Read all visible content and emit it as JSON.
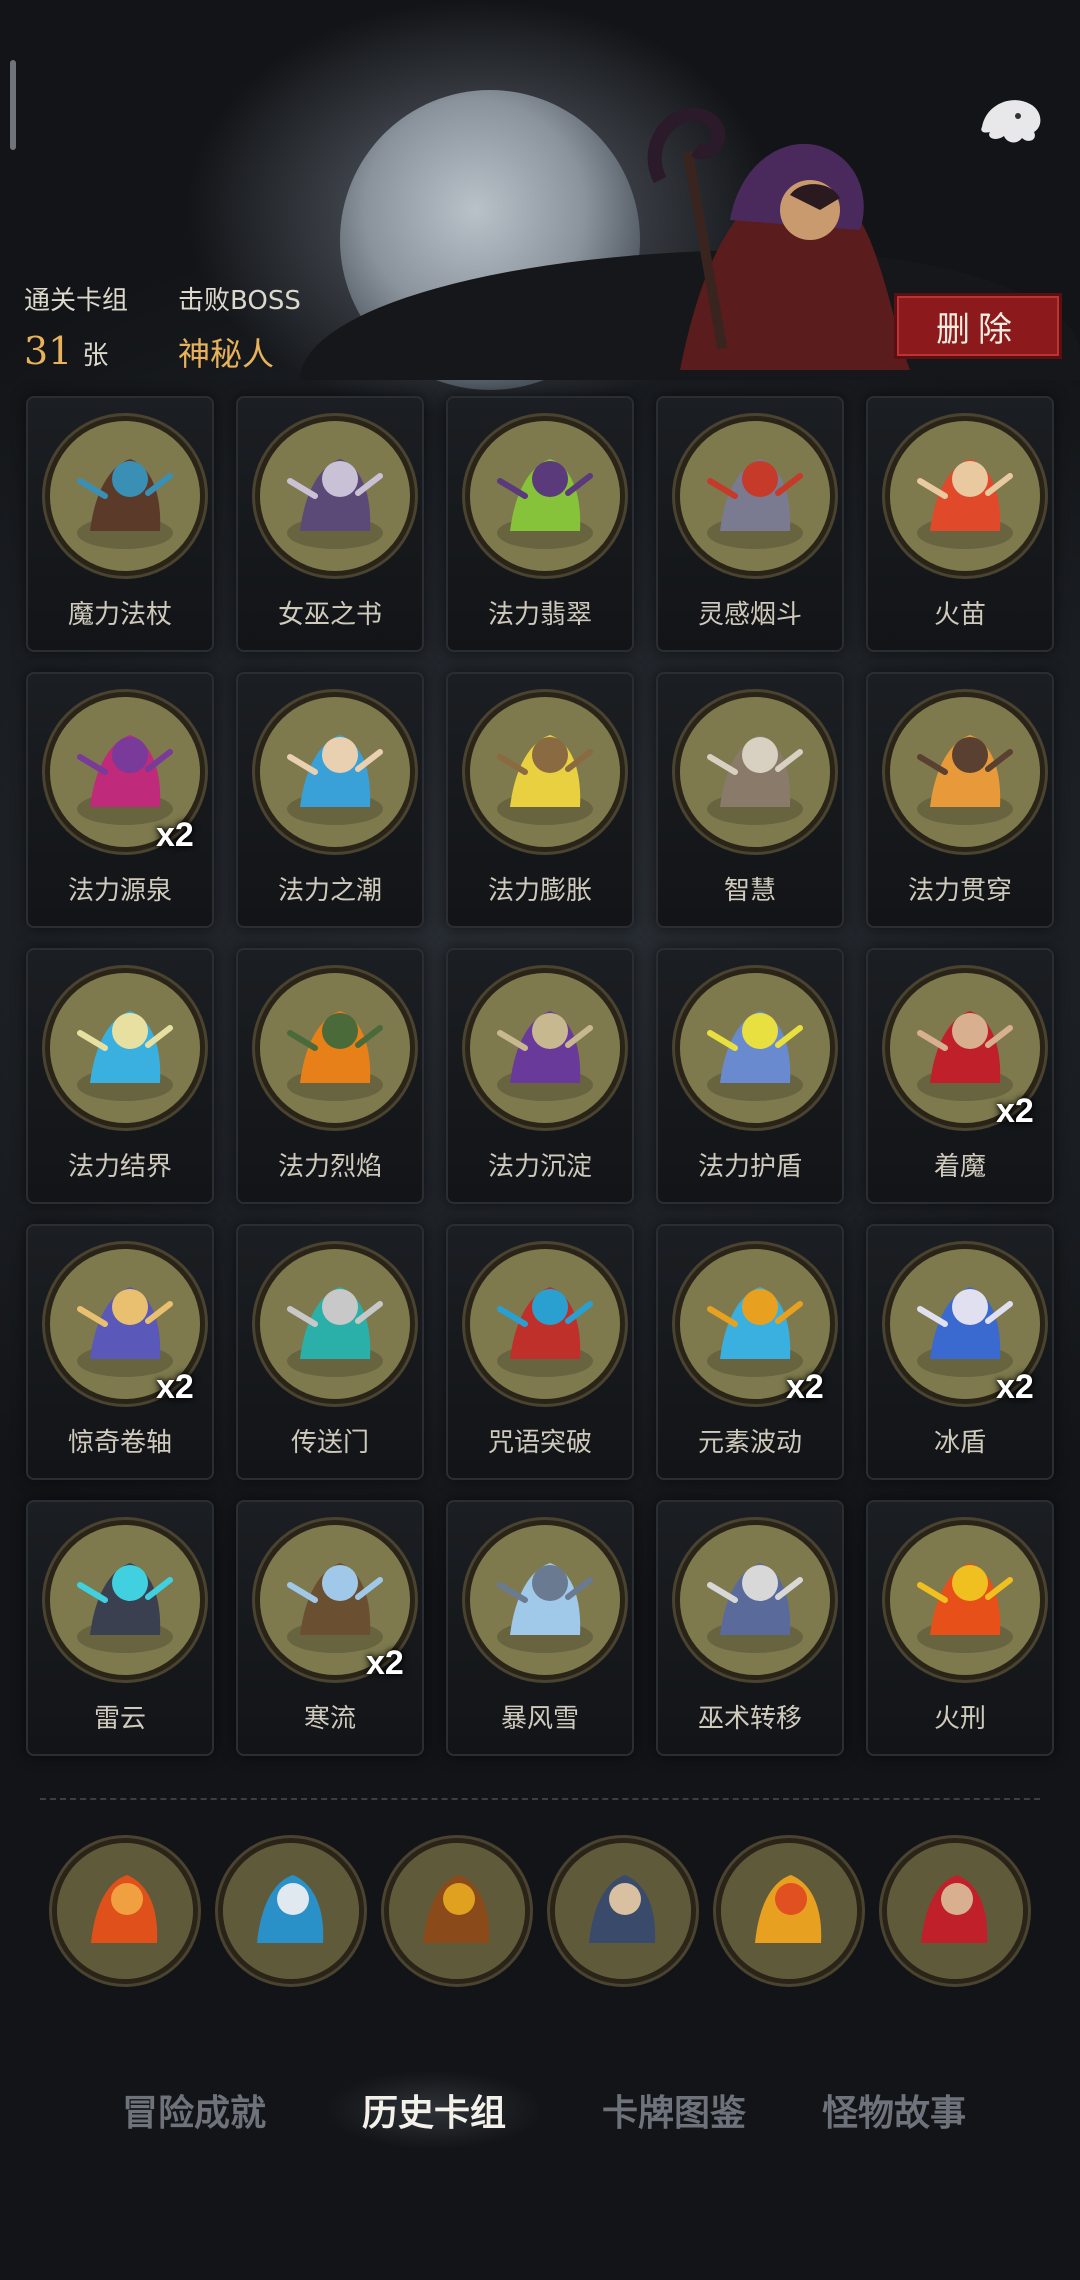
{
  "header": {
    "cleared_label": "通关卡组",
    "cleared_count": "31",
    "cleared_unit": "张",
    "boss_label": "击败BOSS",
    "boss_name": "神秘人",
    "delete_label": "删除"
  },
  "cards": [
    {
      "name": "魔力法杖",
      "count": "",
      "icon": "staff-icon"
    },
    {
      "name": "女巫之书",
      "count": "",
      "icon": "witch-book-icon"
    },
    {
      "name": "法力翡翠",
      "count": "",
      "icon": "emerald-icon"
    },
    {
      "name": "灵感烟斗",
      "count": "",
      "icon": "pipe-icon"
    },
    {
      "name": "火苗",
      "count": "",
      "icon": "flame-hand-icon"
    },
    {
      "name": "法力源泉",
      "count": "x2",
      "icon": "mana-fountain-icon"
    },
    {
      "name": "法力之潮",
      "count": "",
      "icon": "wave-icon"
    },
    {
      "name": "法力膨胀",
      "count": "",
      "icon": "lightning-robe-icon"
    },
    {
      "name": "智慧",
      "count": "",
      "icon": "sage-icon"
    },
    {
      "name": "法力贯穿",
      "count": "",
      "icon": "shield-pierce-icon"
    },
    {
      "name": "法力结界",
      "count": "",
      "icon": "barrier-icon"
    },
    {
      "name": "法力烈焰",
      "count": "",
      "icon": "zombie-fire-icon"
    },
    {
      "name": "法力沉淀",
      "count": "",
      "icon": "hooded-figure-icon"
    },
    {
      "name": "法力护盾",
      "count": "",
      "icon": "orb-shield-icon"
    },
    {
      "name": "着魔",
      "count": "x2",
      "icon": "possessed-icon"
    },
    {
      "name": "惊奇卷轴",
      "count": "x2",
      "icon": "scroll-icon"
    },
    {
      "name": "传送门",
      "count": "",
      "icon": "portal-icon"
    },
    {
      "name": "咒语突破",
      "count": "",
      "icon": "spell-break-icon"
    },
    {
      "name": "元素波动",
      "count": "x2",
      "icon": "element-wave-icon"
    },
    {
      "name": "冰盾",
      "count": "x2",
      "icon": "ice-wizard-icon"
    },
    {
      "name": "雷云",
      "count": "",
      "icon": "thundercloud-icon"
    },
    {
      "name": "寒流",
      "count": "x2",
      "icon": "cold-tree-icon"
    },
    {
      "name": "暴风雪",
      "count": "",
      "icon": "ice-shards-icon"
    },
    {
      "name": "巫术转移",
      "count": "",
      "icon": "wizard-icon"
    },
    {
      "name": "火刑",
      "count": "",
      "icon": "burning-stake-icon"
    }
  ],
  "relics": [
    {
      "icon": "fire-relic-icon"
    },
    {
      "icon": "water-orb-relic-icon"
    },
    {
      "icon": "tome-relic-icon"
    },
    {
      "icon": "card-hand-relic-icon"
    },
    {
      "icon": "phoenix-feather-relic-icon"
    },
    {
      "icon": "possessed-relic-icon"
    }
  ],
  "tabs": [
    {
      "label": "冒险成就",
      "active": false
    },
    {
      "label": "历史卡组",
      "active": true
    },
    {
      "label": "卡牌图鉴",
      "active": false
    },
    {
      "label": "怪物故事",
      "active": false
    }
  ],
  "colors": {
    "accent_gold": "#e8b25a",
    "delete_red": "#8c1a1c",
    "card_bg": "#1b1e22",
    "icon_disc": "#7e7a4e"
  }
}
